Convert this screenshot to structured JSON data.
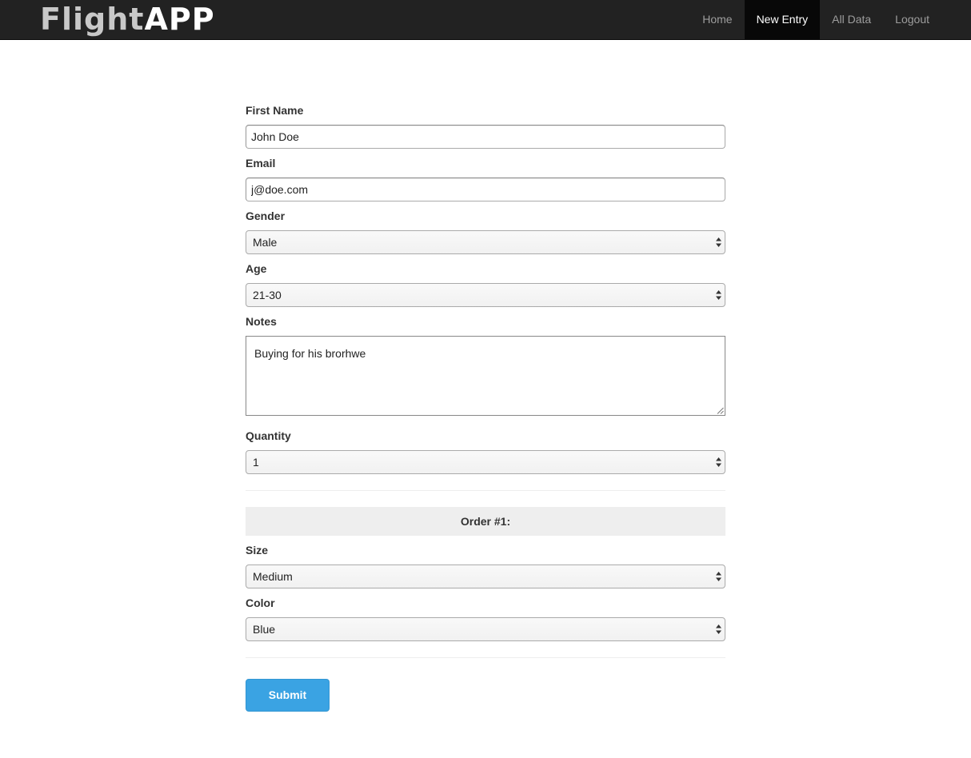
{
  "brand": {
    "part_a": "Flight",
    "part_b": "APP"
  },
  "nav": {
    "items": [
      {
        "label": "Home"
      },
      {
        "label": "New Entry"
      },
      {
        "label": "All Data"
      },
      {
        "label": "Logout"
      }
    ],
    "active": "New Entry"
  },
  "form": {
    "first_name": {
      "label": "First Name",
      "value": "John Doe"
    },
    "email": {
      "label": "Email",
      "value": "j@doe.com"
    },
    "gender": {
      "label": "Gender",
      "value": "Male"
    },
    "age": {
      "label": "Age",
      "value": "21-30"
    },
    "notes": {
      "label": "Notes",
      "value": "Buying for his brorhwe"
    },
    "quantity": {
      "label": "Quantity",
      "value": "1"
    },
    "order": {
      "header": "Order #1:",
      "size": {
        "label": "Size",
        "value": "Medium"
      },
      "color": {
        "label": "Color",
        "value": "Blue"
      }
    },
    "submit_label": "Submit"
  },
  "colors": {
    "navbar_bg": "#222222",
    "nav_active_bg": "#080808",
    "submit_bg": "#3aa3e3",
    "order_header_bg": "#eeeeee"
  },
  "icons": {
    "select_arrows": "updown-arrows-icon",
    "textarea_grip": "resize-grip-icon"
  }
}
